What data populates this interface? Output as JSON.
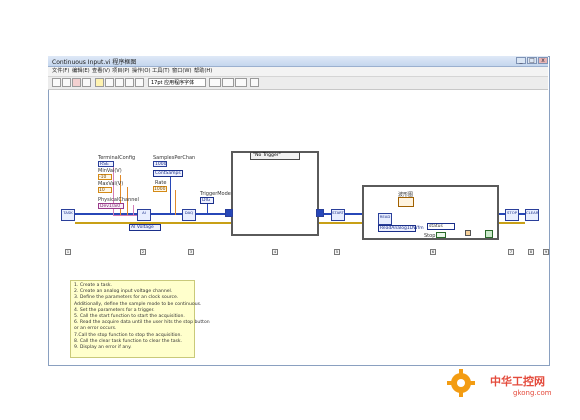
{
  "window": {
    "title": "Continuous Input.vi 程序框图",
    "buttons": [
      "_",
      "□",
      "x"
    ]
  },
  "menu": [
    "文件(F)",
    "编辑(E)",
    "查看(V)",
    "项目(P)",
    "操作(O)",
    "工具(T)",
    "窗口(W)",
    "帮助(H)"
  ],
  "toolbar": {
    "font": "17pt 应用程序字体"
  },
  "diagram": {
    "labels": {
      "terminal_config": "TerminalConfig",
      "min_val": "MinVal(V)",
      "max_val": "MaxVal(V)",
      "physical_channel": "PhysicalChannel",
      "samples_per_chan": "SamplesPerChan",
      "rate": "Rate",
      "trigger_mode": "TriggerMode",
      "waveform_graph": "波形图",
      "stop": "Stop"
    },
    "constants": {
      "terminal_config": "RSE",
      "min_val": "-10",
      "max_val": "10",
      "physical_channel": "Dev1/ai0",
      "samples_per_chan": "ContSamps",
      "rate": "1000",
      "trigger_mode": "DIG",
      "ai_voltage": "AI Voltage",
      "trigger_case": "\"No Trigger\"",
      "read_method": "ReadAnalog1DWfm",
      "status": "status"
    },
    "vi_labels": {
      "create_task": "TASK",
      "create_channel": "AI",
      "timing": "DAQ",
      "trigger": "TRIG",
      "start": "START",
      "read": "READ",
      "stop_task": "STOP",
      "clear_task": "CLEAR"
    },
    "step_numbers": [
      "1",
      "2",
      "3",
      "4",
      "5",
      "6",
      "7",
      "8",
      "9"
    ]
  },
  "comment": [
    "1. Create a task.",
    "2. Create an analog input voltage channel.",
    "3. Define the parameters for an clock source.",
    "Additionally, define the sample mode to be continuous.",
    "4. Set the parameters for a trigger.",
    "5. Call the start function to start the acquisition.",
    "6. Read the acquire data until the user hits the stop button",
    "or an error occurs.",
    "7.Call the stop function to stop the acquisition.",
    "8. Call the clear task function to clear the task.",
    "9. Display an error if any."
  ],
  "watermark": {
    "text": "中华工控网",
    "url": "gkong.com"
  },
  "colors": {
    "task_wire": "#2747b8",
    "error_wire": "#c8a017",
    "comment_bg": "#ffffcc",
    "watermark": "#e44b3c"
  }
}
